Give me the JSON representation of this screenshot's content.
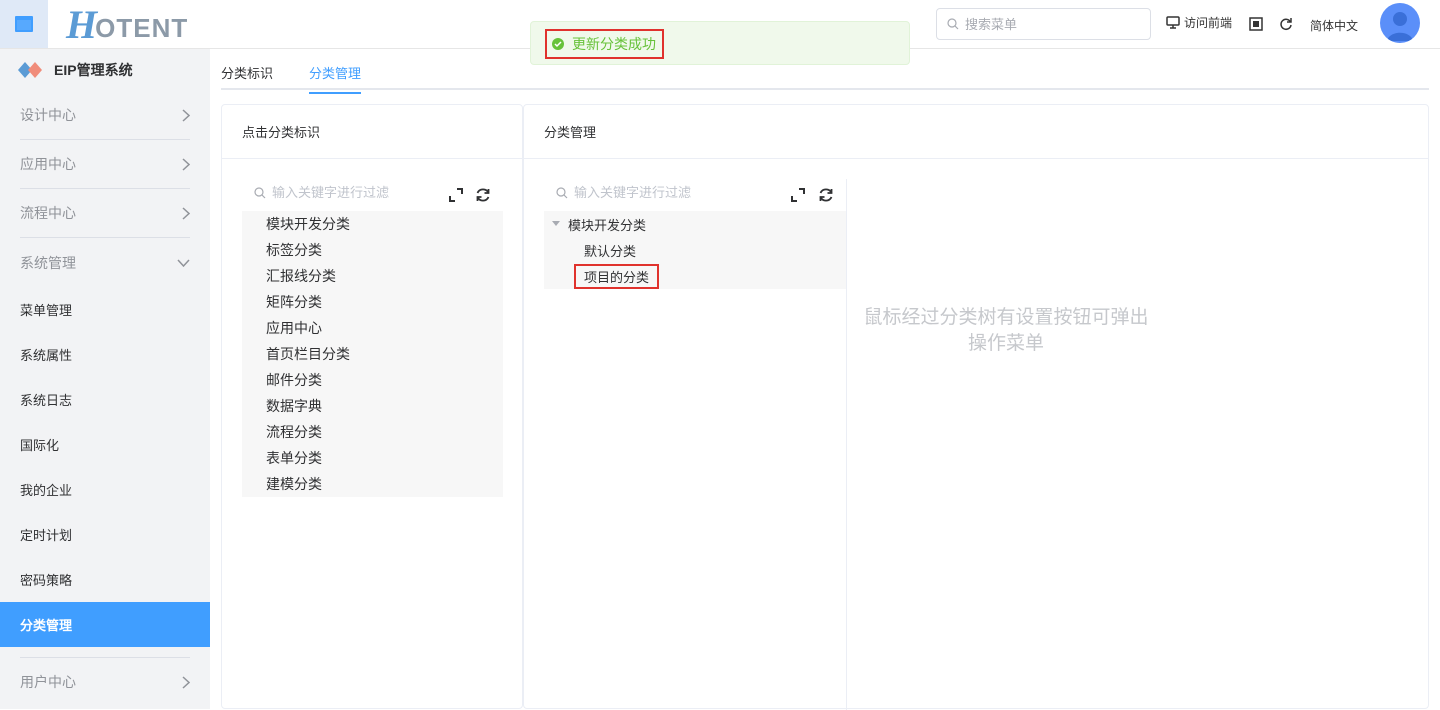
{
  "header": {
    "logo_h": "H",
    "logo_rest": "OTENT",
    "search_placeholder": "搜索菜单",
    "visit_frontend": "访问前端",
    "language": "简体中文"
  },
  "toast": {
    "message": "更新分类成功"
  },
  "sidebar": {
    "system_title": "EIP管理系统",
    "groups": [
      "设计中心",
      "应用中心",
      "流程中心",
      "系统管理"
    ],
    "sub_items": [
      "菜单管理",
      "系统属性",
      "系统日志",
      "国际化",
      "我的企业",
      "定时计划",
      "密码策略",
      "分类管理"
    ],
    "active_item": "分类管理",
    "last_group": "用户中心"
  },
  "tabs": [
    "分类标识",
    "分类管理"
  ],
  "active_tab": "分类管理",
  "left_panel": {
    "title": "点击分类标识",
    "filter_placeholder": "输入关键字进行过滤",
    "nodes": [
      "模块开发分类",
      "标签分类",
      "汇报线分类",
      "矩阵分类",
      "应用中心",
      "首页栏目分类",
      "邮件分类",
      "数据字典",
      "流程分类",
      "表单分类",
      "建模分类"
    ]
  },
  "right_panel": {
    "title": "分类管理",
    "filter_placeholder": "输入关键字进行过滤",
    "root": "模块开发分类",
    "children": [
      "默认分类",
      "项目的分类"
    ],
    "selected_child": "项目的分类",
    "hint_line1": "鼠标经过分类树有设置按钮可弹出",
    "hint_line2": "操作菜单"
  },
  "colors": {
    "primary": "#409eff",
    "success": "#67c23a",
    "highlight": "#e0322d"
  }
}
